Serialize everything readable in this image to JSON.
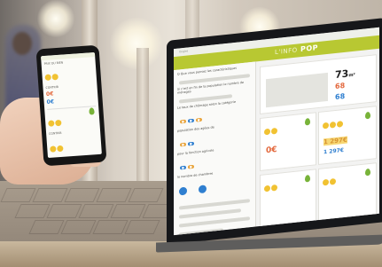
{
  "laptop": {
    "app_brand_prefix": "L'INFO",
    "app_brand": "POP",
    "window_hint": "Onglet",
    "left_panel": {
      "question": "Q Que vous pensez les caractéristiques",
      "rows": [
        "Si c'est en fin de la population le nombre de ménages",
        "Le taux de chômage selon la catégorie",
        "population des agées de",
        "pour la fonction agricole",
        "le nombre de chambres"
      ]
    },
    "stats": {
      "value_main": "73",
      "unit_main": "m²",
      "value_orange": "68",
      "value_blue": "68"
    },
    "cards": [
      {
        "value": "0€",
        "color": "#e3683d"
      },
      {
        "value": "1 297€",
        "color": "#d79433"
      },
      {
        "value": "1 297€",
        "color": "#2f7fd0"
      }
    ]
  },
  "phone": {
    "lines": [
      "PRIX DU BIEN",
      "CONTRIB",
      "0€",
      "0€",
      "CONTRIB"
    ],
    "price": "0€"
  },
  "colors": {
    "accent_green": "#b8c832",
    "orange": "#e3683d",
    "blue": "#2f7fd0"
  }
}
